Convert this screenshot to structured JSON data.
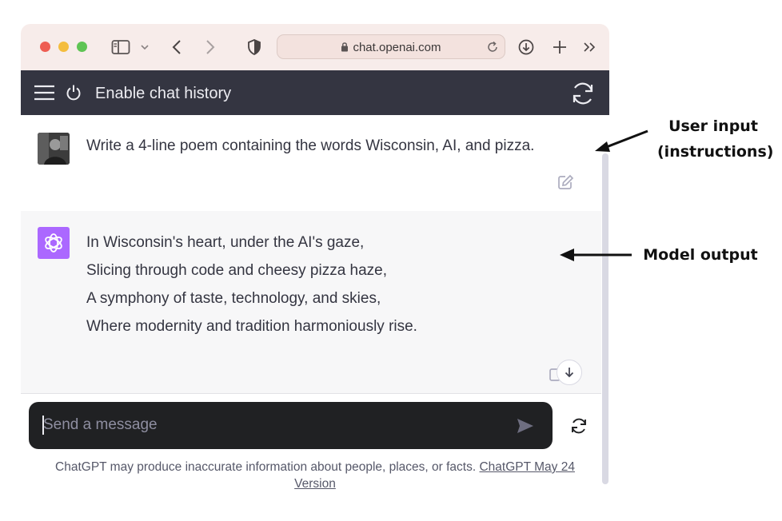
{
  "browser": {
    "url": "chat.openai.com"
  },
  "app_header": {
    "title": "Enable chat history"
  },
  "conversation": {
    "user_message": "Write a 4-line poem containing the words Wisconsin, AI, and pizza.",
    "assistant_lines": [
      "In Wisconsin's heart, under the AI's gaze,",
      "Slicing through code and cheesy pizza haze,",
      "A symphony of taste, technology, and skies,",
      "Where modernity and tradition harmoniously rise."
    ]
  },
  "composer": {
    "placeholder": "Send a message"
  },
  "footer": {
    "text": "ChatGPT may produce inaccurate information about people, places, or facts. ",
    "link": "ChatGPT May 24 Version"
  },
  "annotations": {
    "user_input_line1": "User input",
    "user_input_line2": "(instructions)",
    "model_output": "Model output"
  },
  "colors": {
    "app_header": "#343541",
    "assistant_bg": "#f7f7f8",
    "composer_bg": "#202123",
    "bot_avatar": "#ab68ff"
  }
}
